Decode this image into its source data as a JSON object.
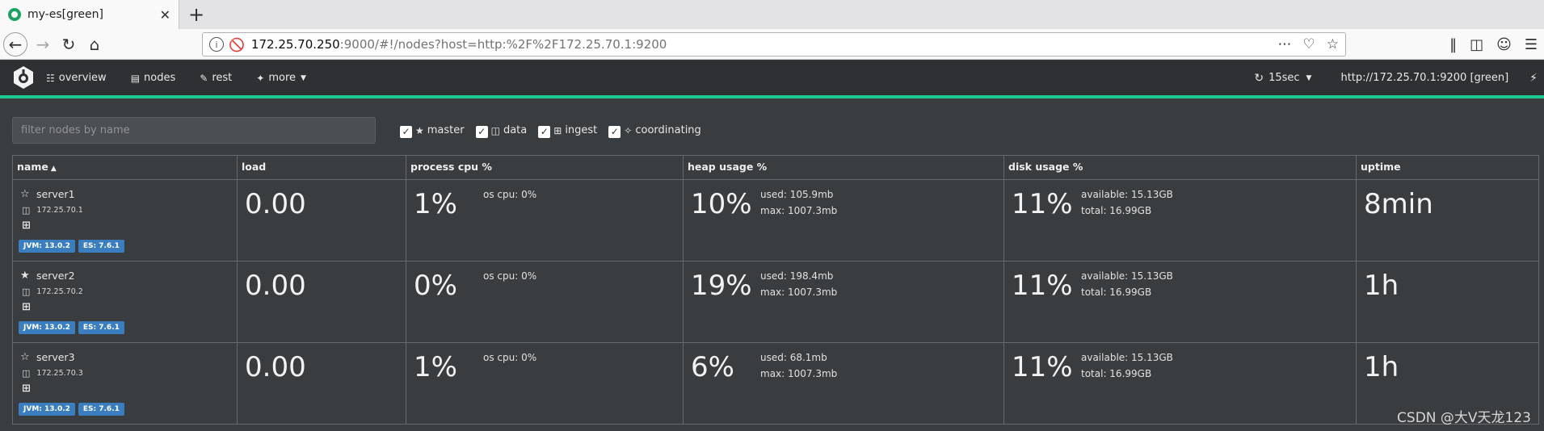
{
  "browser": {
    "tab_title": "my-es[green]",
    "close_glyph": "✕",
    "new_tab_glyph": "+",
    "url_host": "172.25.70.250",
    "url_path": ":9000/#!/nodes?host=http:%2F%2F172.25.70.1:9200"
  },
  "header": {
    "menu": [
      {
        "label": "overview",
        "icon": "sitemap-icon"
      },
      {
        "label": "nodes",
        "icon": "list-icon"
      },
      {
        "label": "rest",
        "icon": "edit-icon"
      },
      {
        "label": "more",
        "icon": "magic-wand-icon"
      }
    ],
    "refresh_label": "15sec",
    "cluster_label": "http://172.25.70.1:9200 [green]"
  },
  "filter": {
    "placeholder": "filter nodes by name",
    "roles": [
      {
        "label": "master",
        "checked": true,
        "icon": "star-icon"
      },
      {
        "label": "data",
        "checked": true,
        "icon": "hdd-icon"
      },
      {
        "label": "ingest",
        "checked": true,
        "icon": "crop-icon"
      },
      {
        "label": "coordinating",
        "checked": true,
        "icon": "crosshair-icon"
      }
    ]
  },
  "table": {
    "columns": [
      "name",
      "load",
      "process cpu %",
      "heap usage %",
      "disk usage %",
      "uptime"
    ],
    "rows": [
      {
        "name": "server1",
        "master": false,
        "host": "172.25.70.1",
        "jvm": "JVM: 13.0.2",
        "es": "ES: 7.6.1",
        "load": "0.00",
        "cpu": "1%",
        "os_cpu": "os cpu: 0%",
        "heap": "10%",
        "heap_used": "used: 105.9mb",
        "heap_max": "max: 1007.3mb",
        "disk": "11%",
        "disk_available": "available: 15.13GB",
        "disk_total": "total: 16.99GB",
        "uptime": "8min"
      },
      {
        "name": "server2",
        "master": true,
        "host": "172.25.70.2",
        "jvm": "JVM: 13.0.2",
        "es": "ES: 7.6.1",
        "load": "0.00",
        "cpu": "0%",
        "os_cpu": "os cpu: 0%",
        "heap": "19%",
        "heap_used": "used: 198.4mb",
        "heap_max": "max: 1007.3mb",
        "disk": "11%",
        "disk_available": "available: 15.13GB",
        "disk_total": "total: 16.99GB",
        "uptime": "1h"
      },
      {
        "name": "server3",
        "master": false,
        "host": "172.25.70.3",
        "jvm": "JVM: 13.0.2",
        "es": "ES: 7.6.1",
        "load": "0.00",
        "cpu": "1%",
        "os_cpu": "os cpu: 0%",
        "heap": "6%",
        "heap_used": "used: 68.1mb",
        "heap_max": "max: 1007.3mb",
        "disk": "11%",
        "disk_available": "available: 15.13GB",
        "disk_total": "total: 16.99GB",
        "uptime": "1h"
      }
    ]
  },
  "watermark": "CSDN @大V天龙123",
  "colors": {
    "accent": "#1ec98f",
    "badge": "#3a7ebf",
    "background": "#3a3d40"
  }
}
